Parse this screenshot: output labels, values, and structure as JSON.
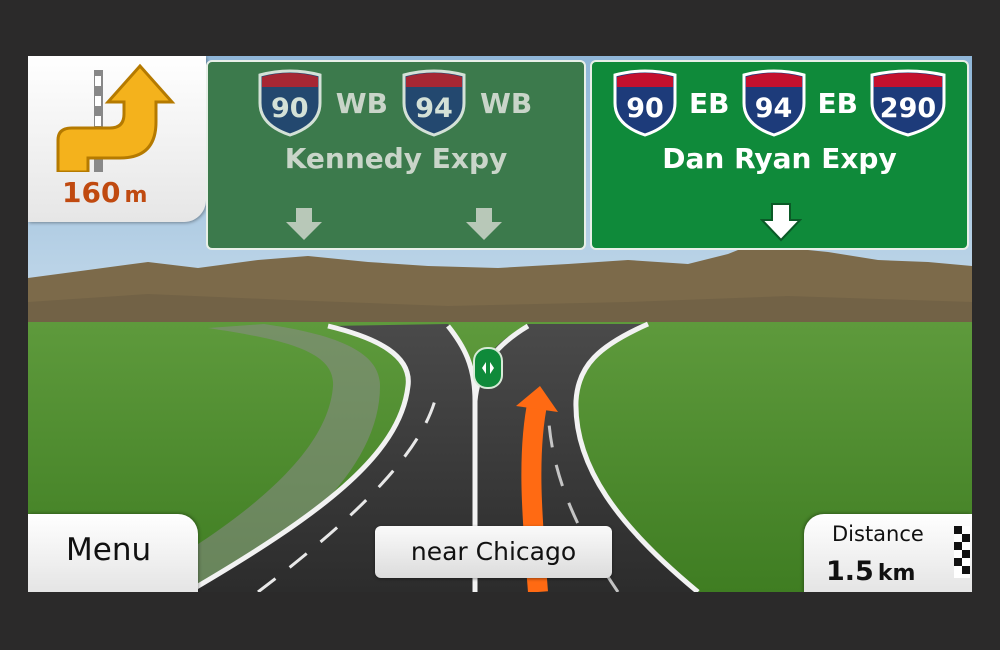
{
  "next_turn": {
    "icon": "keep-right-arrow-icon",
    "distance": "160",
    "unit": "m"
  },
  "signs": [
    {
      "shields": [
        {
          "number": "90",
          "direction": "WB"
        },
        {
          "number": "94",
          "direction": "WB"
        }
      ],
      "road": "Kennedy Expy",
      "arrows": [
        "down-arrow-icon",
        "down-arrow-icon"
      ],
      "active": false
    },
    {
      "shields": [
        {
          "number": "90",
          "direction": "EB"
        },
        {
          "number": "94",
          "direction": "EB"
        },
        {
          "number": "290",
          "direction": ""
        }
      ],
      "road": "Dan Ryan Expy",
      "arrows": [
        "down-arrow-icon"
      ],
      "active": true
    }
  ],
  "menu": {
    "label": "Menu"
  },
  "current_street": "near Chicago",
  "distance_panel": {
    "label": "Distance",
    "value": "1.5",
    "unit": "km",
    "icon": "checkered-flag-icon"
  },
  "colors": {
    "active_sign": "#0f8a3a",
    "inactive_sign": "#3c7a4c",
    "route": "#ff6a13",
    "turn_arrow": "#f4b21c",
    "distance_text": "#c04a10"
  }
}
